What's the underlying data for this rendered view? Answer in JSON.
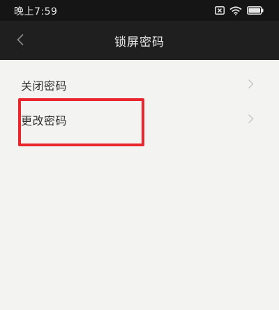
{
  "status_bar": {
    "time": "晚上7:59",
    "icons": [
      "sim-x-icon",
      "wifi-icon",
      "battery-icon"
    ]
  },
  "header": {
    "back_icon": "chevron-left-icon",
    "title": "锁屏密码"
  },
  "menu": {
    "items": [
      {
        "label": "关闭密码",
        "icon": "chevron-right-icon"
      },
      {
        "label": "更改密码",
        "icon": "chevron-right-icon"
      }
    ]
  },
  "colors": {
    "annotation_border": "#e8262b",
    "content_bg": "#f3f3f1",
    "header_bg": "#1f1f1f"
  }
}
